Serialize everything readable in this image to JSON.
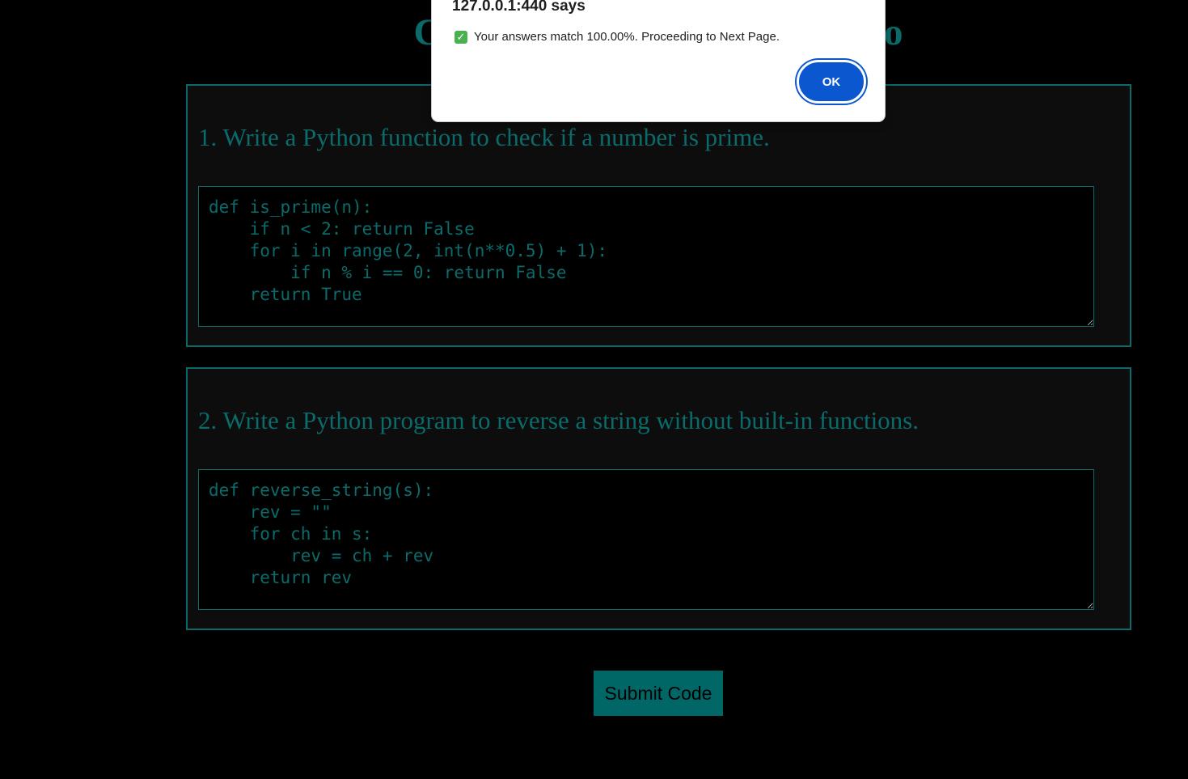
{
  "page": {
    "title": "Coding Test for San Francisco"
  },
  "questions": [
    {
      "text": "1. Write a Python function to check if a number is prime.",
      "answer": "def is_prime(n):\n    if n < 2: return False\n    for i in range(2, int(n**0.5) + 1):\n        if n % i == 0: return False\n    return True"
    },
    {
      "text": "2. Write a Python program to reverse a string without built-in functions.",
      "answer": "def reverse_string(s):\n    rev = \"\"\n    for ch in s:\n        rev = ch + rev\n    return rev"
    }
  ],
  "submit": {
    "label": "Submit Code"
  },
  "alert": {
    "origin": "127.0.0.1:440 says",
    "icon": "check-icon",
    "message": "Your answers match 100.00%. Proceeding to Next Page.",
    "ok_label": "OK"
  },
  "colors": {
    "accent": "#0b6b6b",
    "background": "#000000",
    "card_background": "#0d0d0d",
    "button": "#006666",
    "dialog_button": "#0b57d0"
  }
}
